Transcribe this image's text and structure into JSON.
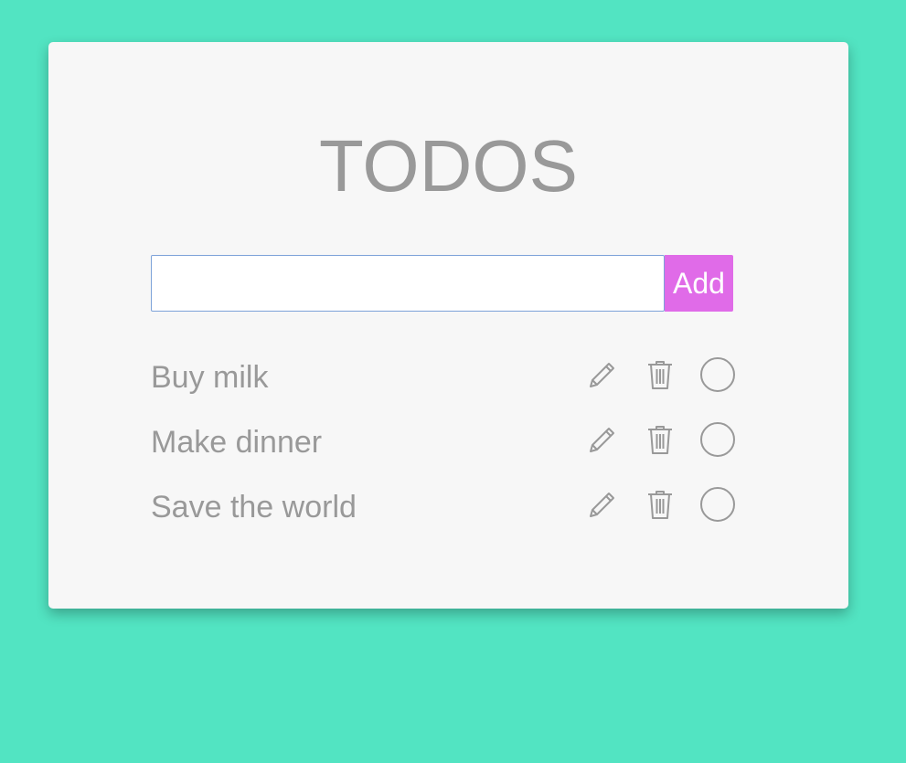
{
  "title": "TODOS",
  "form": {
    "input_value": "",
    "input_placeholder": "",
    "add_label": "Add"
  },
  "todos": [
    {
      "label": "Buy milk",
      "completed": false
    },
    {
      "label": "Make dinner",
      "completed": false
    },
    {
      "label": "Save the world",
      "completed": false
    }
  ],
  "icons": {
    "edit": "pencil-icon",
    "delete": "trash-icon",
    "complete": "circle-icon"
  },
  "colors": {
    "background": "#52e4c2",
    "card": "#f7f7f7",
    "text": "#999999",
    "accent": "#e06be8",
    "input_border": "#7da2d9"
  }
}
